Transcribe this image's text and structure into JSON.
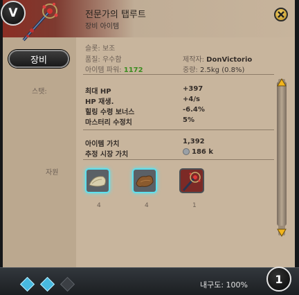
{
  "header": {
    "grade": "V",
    "item_name": "전문가의 탭루트",
    "item_type": "장비 아이템",
    "equip_label": "장비"
  },
  "info": {
    "slot_label": "슬롯: 보조",
    "grade_label": "품질: 우수함",
    "power_label": "아이템 파워:",
    "power_value": "1172",
    "crafter_label": "제작자:",
    "crafter_value": "DonVictorio",
    "weight_label": "중량:",
    "weight_value": "2.5kg (0.8%)"
  },
  "stats": {
    "section_label": "스탯:",
    "rows": [
      {
        "name": "최대 HP",
        "value": "+397"
      },
      {
        "name": "HP 재생.",
        "value": "+4/s"
      },
      {
        "name": "힐링 수령 보너스",
        "value": "-6.4%"
      },
      {
        "name": "마스터리 수정치",
        "value": "5%"
      }
    ]
  },
  "value": {
    "item_value_label": "아이템 가치",
    "item_value": "1,392",
    "market_label": "추정 시장 가치",
    "market_value": "186 k"
  },
  "resources": {
    "section_label": "자원",
    "items": [
      {
        "count": "4",
        "icon": "cloth-icon"
      },
      {
        "count": "4",
        "icon": "leather-icon"
      },
      {
        "count": "1",
        "icon": "artifact-icon"
      }
    ]
  },
  "footer": {
    "durability": "내구도: 100%",
    "tier": "1"
  },
  "colors": {
    "header_red": "#8a2e24",
    "parchment": "#c8b59d",
    "power_green": "#3a8c1f",
    "gem_cyan": "#4fb5d8"
  }
}
